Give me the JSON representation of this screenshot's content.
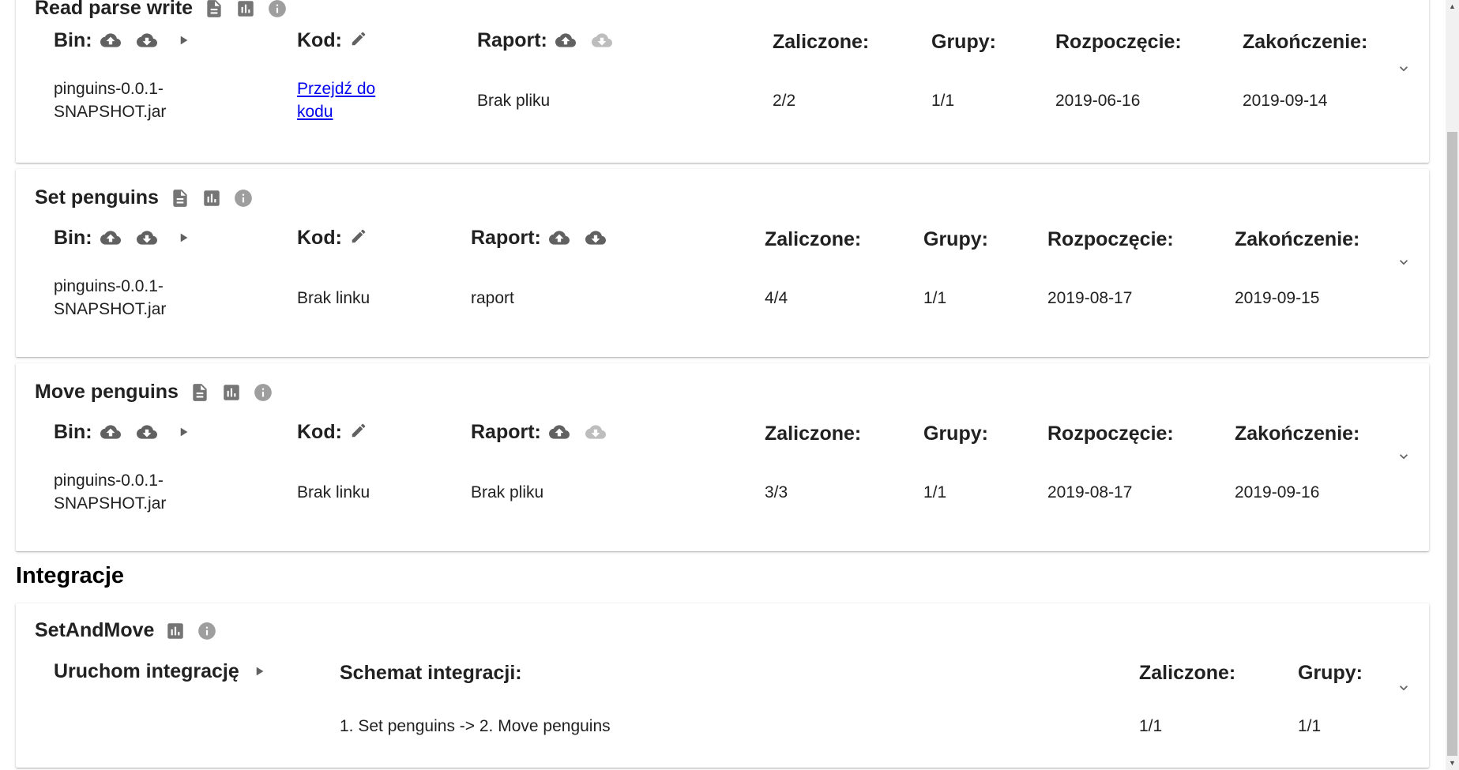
{
  "headers": {
    "bin": "Bin:",
    "code": "Kod:",
    "report": "Raport:",
    "passed": "Zaliczone:",
    "groups": "Grupy:",
    "start": "Rozpoczęcie:",
    "end": "Zakończenie:"
  },
  "tasks": [
    {
      "title": "Read parse write",
      "bin_line1": "pinguins-0.0.1-",
      "bin_line2": "SNAPSHOT.jar",
      "code_link_line1": "Przejdź do",
      "code_link_line2": "kodu",
      "report": "Brak pliku",
      "passed": "2/2",
      "groups": "1/1",
      "start": "2019-06-16",
      "end": "2019-09-14"
    },
    {
      "title": "Set penguins",
      "bin_line1": "pinguins-0.0.1-",
      "bin_line2": "SNAPSHOT.jar",
      "code": "Brak linku",
      "report": "raport",
      "passed": "4/4",
      "groups": "1/1",
      "start": "2019-08-17",
      "end": "2019-09-15"
    },
    {
      "title": "Move penguins",
      "bin_line1": "pinguins-0.0.1-",
      "bin_line2": "SNAPSHOT.jar",
      "code": "Brak linku",
      "report": "Brak pliku",
      "passed": "3/3",
      "groups": "1/1",
      "start": "2019-08-17",
      "end": "2019-09-16"
    }
  ],
  "integrations": {
    "section_title": "Integracje",
    "items": [
      {
        "title": "SetAndMove",
        "run_label": "Uruchom integrację",
        "schema_header": "Schemat integracji:",
        "schema": "1. Set penguins -> 2. Move penguins",
        "passed_header": "Zaliczone:",
        "passed": "1/1",
        "groups_header": "Grupy:",
        "groups": "1/1"
      }
    ]
  },
  "colors": {
    "icon": "#616161",
    "icon_disabled": "#bdbdbd",
    "link": "#0000ee"
  }
}
